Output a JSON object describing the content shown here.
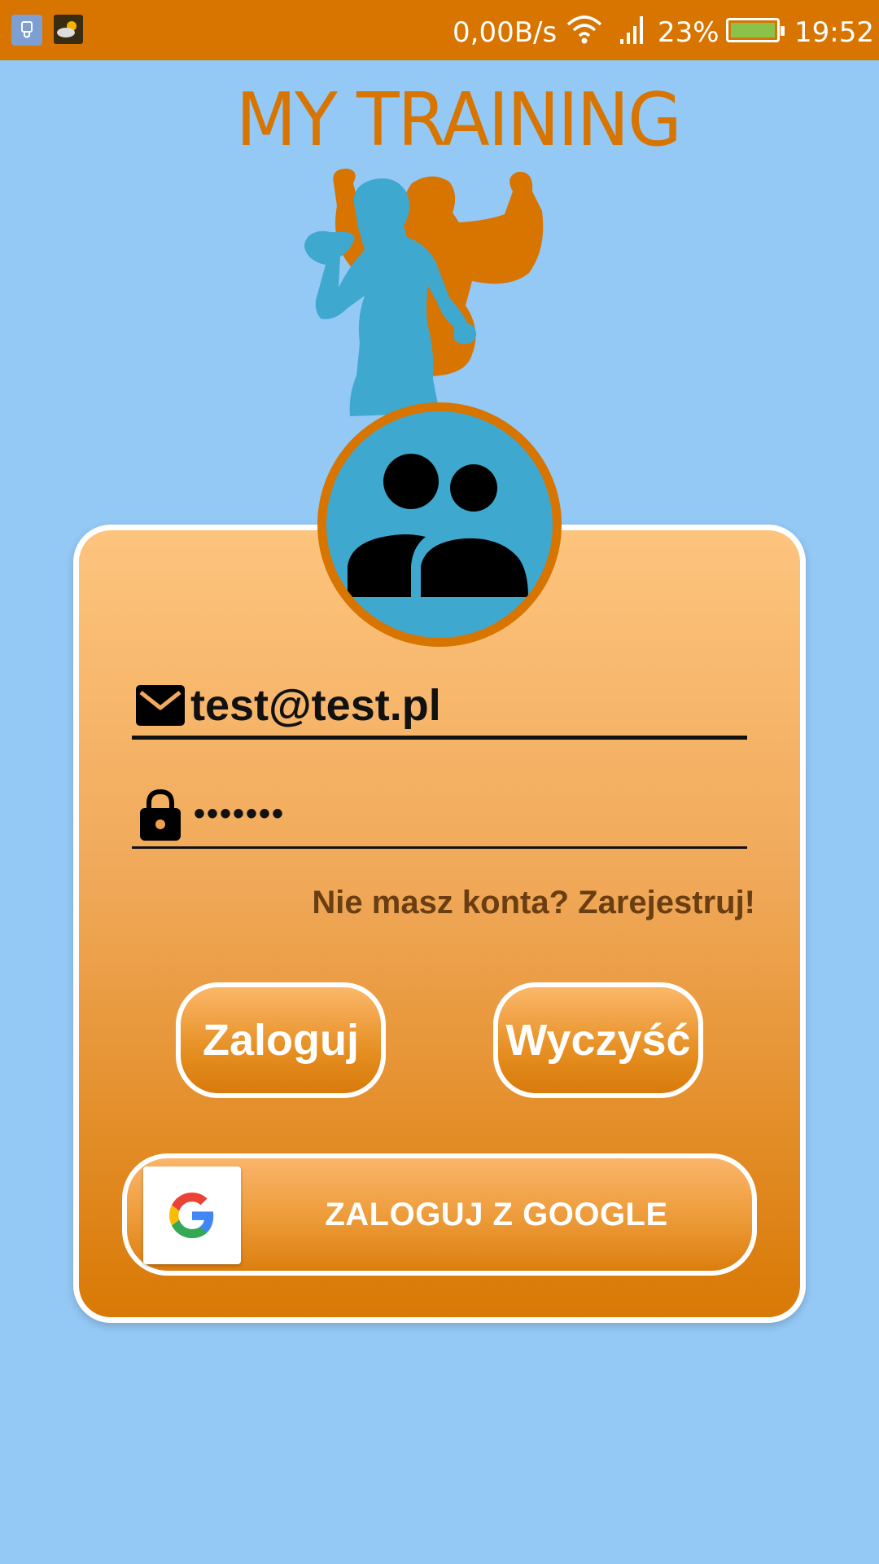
{
  "status_bar": {
    "network_speed": "0,00B/s",
    "battery_percent": "23%",
    "time": "19:52",
    "icons": [
      "usb-icon",
      "weather-icon",
      "wifi-icon",
      "signal-icon",
      "battery-icon"
    ]
  },
  "logo": {
    "title": "MY TRAINING"
  },
  "login_form": {
    "email_value": "test@test.pl",
    "password_mask": "•••••••",
    "register_link": "Nie masz konta? Zarejestruj!",
    "login_button": "Zaloguj",
    "clear_button": "Wyczyść",
    "google_button": "ZALOGUJ Z GOOGLE"
  },
  "colors": {
    "accent_orange": "#d87400",
    "background_blue": "#94c9f5",
    "avatar_blue": "#3fa8cf"
  }
}
